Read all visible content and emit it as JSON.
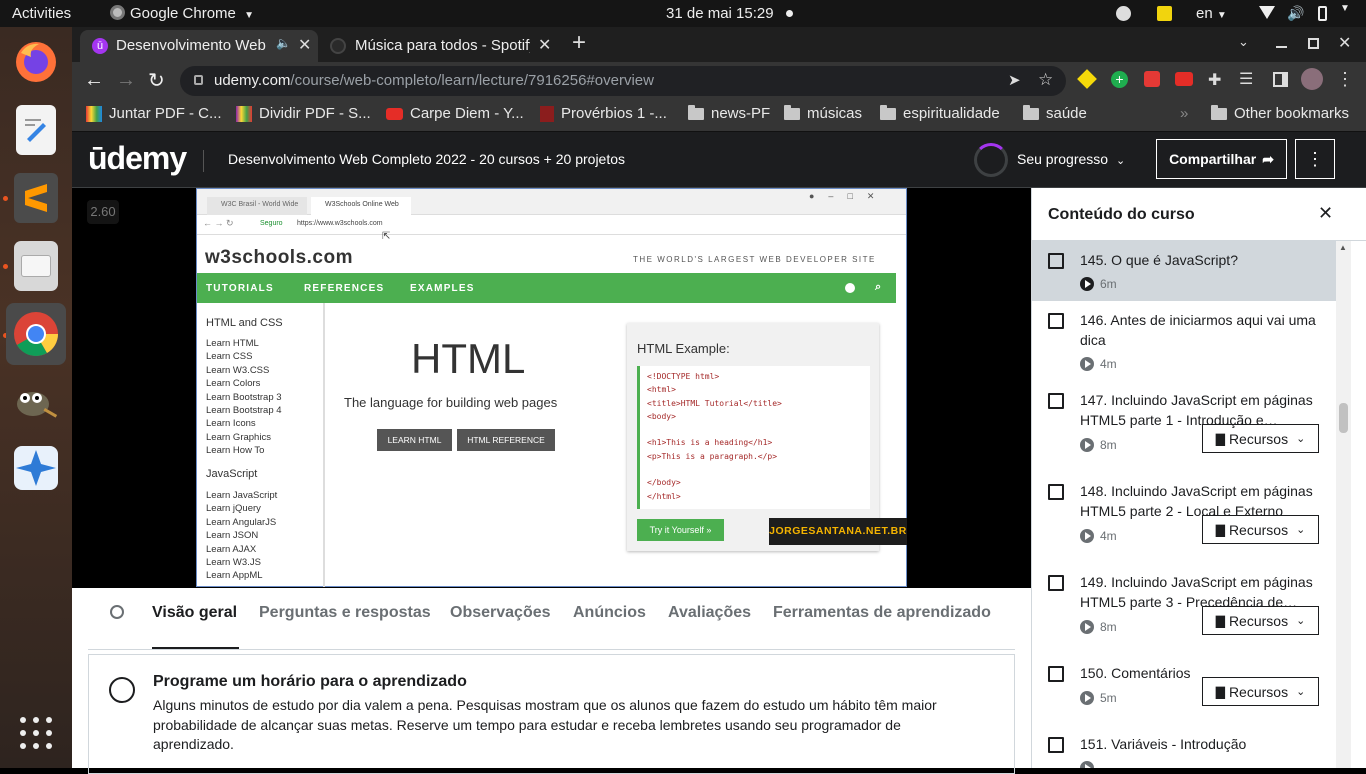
{
  "topbar": {
    "activities": "Activities",
    "app": "Google Chrome",
    "datetime": "31 de mai  15:29",
    "lang": "en"
  },
  "dock": {
    "items": [
      "firefox-icon",
      "text-editor-icon",
      "sublime-text-icon",
      "files-icon",
      "chrome-icon",
      "gimp-icon",
      "app-icon"
    ]
  },
  "browser": {
    "tabs": [
      {
        "title": "Desenvolvimento Web Completo"
      },
      {
        "title": "Música para todos - Spotify"
      }
    ],
    "url_domain": "udemy.com",
    "url_path": "/course/web-completo/learn/lecture/7916256#overview",
    "bookmarks": [
      "Juntar PDF - C...",
      "Dividir PDF - S...",
      "Carpe Diem - Y...",
      "Provérbios 1 -...",
      "news-PF",
      "músicas",
      "espiritualidade",
      "saúde"
    ],
    "other_bookmarks": "Other bookmarks"
  },
  "udemy": {
    "logo": "ūdemy",
    "course_title": "Desenvolvimento Web Completo 2022 - 20 cursos + 20 projetos",
    "progress_label": "Seu progresso",
    "share_label": "Compartilhar"
  },
  "video": {
    "speed": "2.60",
    "w3": {
      "tab1": "W3C Brasil - World Wide",
      "tab2": "W3Schools Online Web",
      "address_secure": "Seguro",
      "address": "https://www.w3schools.com",
      "logo": "w3schools.com",
      "tagline": "THE WORLD'S LARGEST WEB DEVELOPER SITE",
      "nav": [
        "TUTORIALS",
        "REFERENCES",
        "EXAMPLES"
      ],
      "side_head1": "HTML and CSS",
      "side_links1": [
        "Learn HTML",
        "Learn CSS",
        "Learn W3.CSS",
        "Learn Colors",
        "Learn Bootstrap 3",
        "Learn Bootstrap 4",
        "Learn Icons",
        "Learn Graphics",
        "Learn How To"
      ],
      "side_head2": "JavaScript",
      "side_links2": [
        "Learn JavaScript",
        "Learn jQuery",
        "Learn AngularJS",
        "Learn JSON",
        "Learn AJAX",
        "Learn W3.JS",
        "Learn AppML"
      ],
      "hero_title": "HTML",
      "hero_sub": "The language for building web pages",
      "btn_learn": "LEARN HTML",
      "btn_ref": "HTML REFERENCE",
      "example_title": "HTML Example:",
      "code": [
        "<!DOCTYPE html>",
        "<html>",
        "<title>HTML Tutorial</title>",
        "<body>",
        "",
        "<h1>This is a heading</h1>",
        "<p>This is a paragraph.</p>",
        "",
        "</body>",
        "</html>"
      ],
      "try_btn": "Try it Yourself »",
      "watermark": "JORGESANTANA.NET.BR"
    }
  },
  "tabs": [
    "Visão geral",
    "Perguntas e respostas",
    "Observações",
    "Anúncios",
    "Avaliações",
    "Ferramentas de aprendizado"
  ],
  "reminder": {
    "title": "Programe um horário para o aprendizado",
    "body": "Alguns minutos de estudo por dia valem a pena. Pesquisas mostram que os alunos que fazem do estudo um hábito têm maior probabilidade de alcançar suas metas. Reserve um tempo para estudar e receba lembretes usando seu programador de aprendizado."
  },
  "sidebar": {
    "title": "Conteúdo do curso",
    "resources_label": "Recursos",
    "items": [
      {
        "title": "145. O que é JavaScript?",
        "duration": "6m"
      },
      {
        "title": "146. Antes de iniciarmos aqui vai uma dica",
        "duration": "4m"
      },
      {
        "title": "147. Incluindo JavaScript em páginas HTML5 parte 1 - Introdução e…",
        "duration": "8m"
      },
      {
        "title": "148. Incluindo JavaScript em páginas HTML5 parte 2 - Local e Externo",
        "duration": "4m"
      },
      {
        "title": "149. Incluindo JavaScript em páginas HTML5 parte 3 - Precedência de…",
        "duration": "8m"
      },
      {
        "title": "150. Comentários",
        "duration": "5m"
      },
      {
        "title": "151. Variáveis - Introdução",
        "duration": ""
      }
    ]
  },
  "colors": {
    "udemy_purple": "#a435f0",
    "w3_green": "#4caf50",
    "active_row": "#d1d7dc"
  }
}
